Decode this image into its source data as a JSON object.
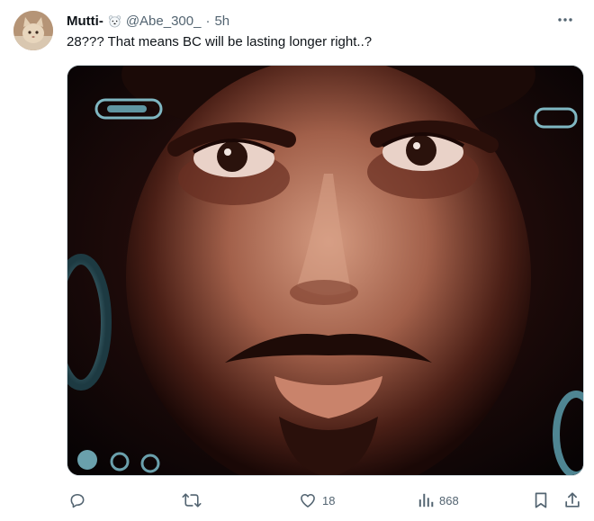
{
  "tweet": {
    "author_name": "Mutti-",
    "author_handle": "@Abe_300_",
    "separator": "·",
    "time_ago": "5h",
    "text": "28??? That means BC will be lasting longer right..?"
  },
  "actions": {
    "reply_count": "",
    "retweet_count": "",
    "like_count": "18",
    "view_count": "868"
  },
  "icons": [
    "avatar-cat",
    "polar-bear-emoji",
    "more-icon",
    "reply-icon",
    "retweet-icon",
    "like-icon",
    "views-icon",
    "bookmark-icon",
    "share-icon"
  ],
  "colors": {
    "text": "#0f1419",
    "muted": "#536471",
    "border": "#cfd9de",
    "background": "#ffffff"
  }
}
